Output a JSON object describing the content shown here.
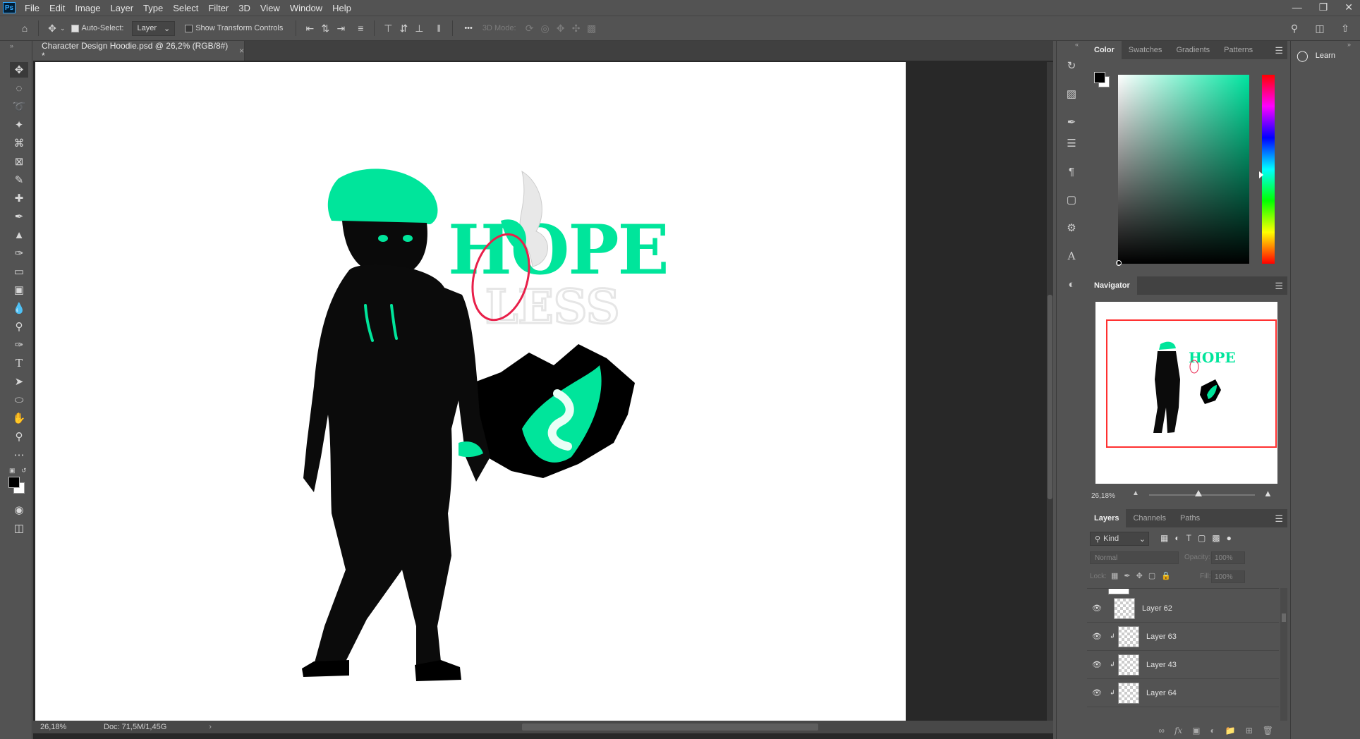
{
  "app": {
    "logo": "Ps",
    "menu": [
      "File",
      "Edit",
      "Image",
      "Layer",
      "Type",
      "Select",
      "Filter",
      "3D",
      "View",
      "Window",
      "Help"
    ],
    "window_controls": [
      "minimize-icon",
      "restore-icon",
      "close-icon"
    ]
  },
  "options": {
    "auto_select_label": "Auto-Select:",
    "auto_select_checked": true,
    "auto_select_target": "Layer",
    "show_transform_label": "Show Transform Controls",
    "show_transform_checked": false,
    "more_label": "•••",
    "mode_3d_label": "3D Mode:"
  },
  "document": {
    "tab_title": "Character Design Hoodie.psd @ 26,2% (RGB/8#) *",
    "close_glyph": "×",
    "artwork_text_top": "HOPE",
    "artwork_text_bottom": "LESS",
    "zoom": "26,18%",
    "doc_info": "Doc: 71,5M/1,45G"
  },
  "color_panel": {
    "tabs": [
      "Color",
      "Swatches",
      "Gradients",
      "Patterns"
    ],
    "active_tab": "Color",
    "foreground": "#000000",
    "background": "#ffffff",
    "hue_color": "#00e5a0"
  },
  "navigator": {
    "title": "Navigator",
    "zoom": "26,18%"
  },
  "layers_panel": {
    "tabs": [
      "Layers",
      "Channels",
      "Paths"
    ],
    "active_tab": "Layers",
    "filter_kind": "Kind",
    "blend_mode": "Normal",
    "opacity_label": "Opacity:",
    "opacity_value": "100%",
    "lock_label": "Lock:",
    "fill_label": "Fill:",
    "fill_value": "100%",
    "layers": [
      {
        "name": "Layer 62",
        "visible": true,
        "clipped": false
      },
      {
        "name": "Layer 63",
        "visible": true,
        "clipped": true
      },
      {
        "name": "Layer 43",
        "visible": true,
        "clipped": true
      },
      {
        "name": "Layer 64",
        "visible": true,
        "clipped": true
      }
    ]
  },
  "learn_panel": {
    "label": "Learn"
  },
  "colors": {
    "accent_green": "#00e59b",
    "ui_bg": "#535353",
    "canvas_bg": "#282828",
    "nav_frame": "#ff3030"
  }
}
